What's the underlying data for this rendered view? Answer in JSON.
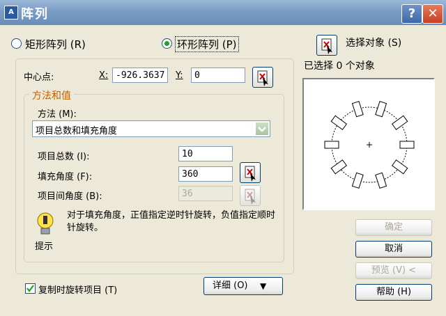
{
  "window": {
    "title": "阵列",
    "app_icon_text": "A",
    "help_label": "?",
    "close_label": "✕"
  },
  "mode": {
    "rect_label": "矩形阵列 (R)",
    "polar_label": "环形阵列 (P)",
    "selected": "polar"
  },
  "select": {
    "label": "选择对象 (S)",
    "status": "已选择 0 个对象"
  },
  "center": {
    "label": "中心点:",
    "x_label": "X:",
    "x_value": "-926.3637",
    "y_label": "Y:",
    "y_value": "0"
  },
  "method_group": {
    "title": "方法和值",
    "method_label": "方法 (M):",
    "method_value": "项目总数和填充角度",
    "total_label": "项目总数 (I):",
    "total_value": "10",
    "fill_label": "填充角度 (F):",
    "fill_value": "360",
    "between_label": "项目间角度 (B):",
    "between_value": "36"
  },
  "tip": {
    "text": "对于填充角度，正值指定逆时针旋转，负值指定顺时针旋转。",
    "label": "提示"
  },
  "rotate": {
    "label": "复制时旋转项目 (T)",
    "checked": true
  },
  "detail_button": "详细 (O)",
  "buttons": {
    "ok": "确定",
    "cancel": "取消",
    "preview": "预览 (V) <",
    "help": "帮助 (H)"
  },
  "preview_image": {
    "item_count": 10
  },
  "colors": {
    "titlebar": "#7a9cc4",
    "radio_dot": "#21a121",
    "close": "#c84020"
  }
}
